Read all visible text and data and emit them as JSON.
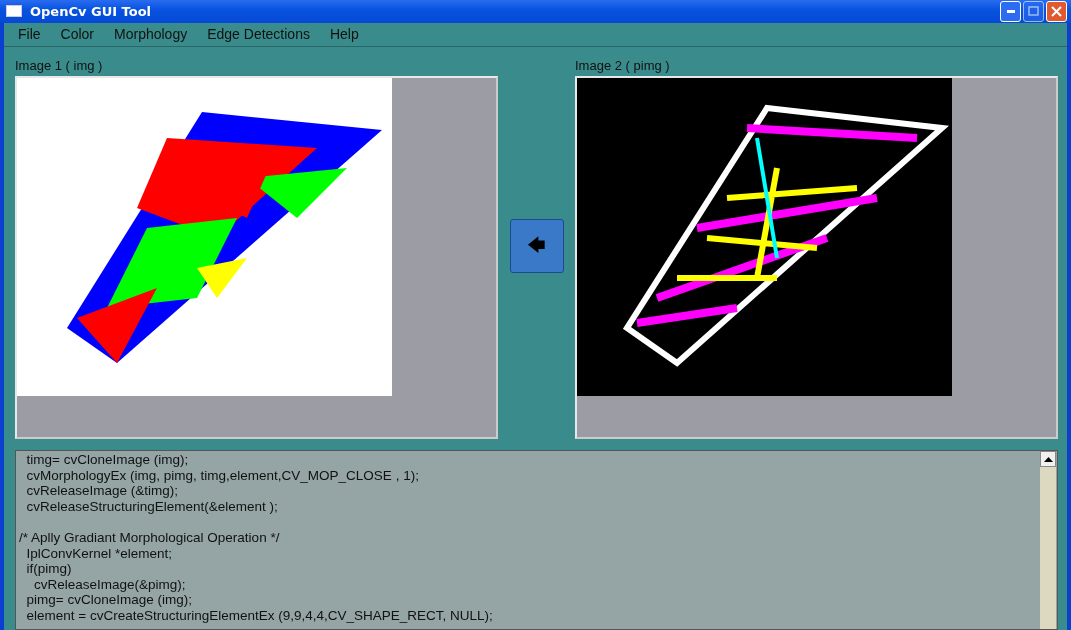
{
  "window": {
    "title": "OpenCv GUI Tool"
  },
  "menu": [
    "File",
    "Color",
    "Morphology",
    "Edge Detections",
    "Help"
  ],
  "panels": [
    {
      "label": "Image 1 ( img )",
      "kind": "source"
    },
    {
      "label": "Image 2 ( pimg )",
      "kind": "result"
    }
  ],
  "copy_button": {
    "label": "🡄"
  },
  "code_blocks": [
    {
      "lines": [
        "  timg= cvCloneImage (img);",
        "  cvMorphologyEx (img, pimg, timg,element,CV_MOP_CLOSE , 1);",
        "  cvReleaseImage (&timg);",
        "  cvReleaseStructuringElement(&element );"
      ]
    },
    {
      "lines": [
        "/* Aplly Gradiant Morphological Operation */",
        "  IplConvKernel *element;",
        "  if(pimg)",
        "    cvReleaseImage(&pimg);",
        "  pimg= cvCloneImage (img);",
        "  element = cvCreateStructuringElementEx (9,9,4,4,CV_SHAPE_RECT, NULL);"
      ]
    }
  ]
}
